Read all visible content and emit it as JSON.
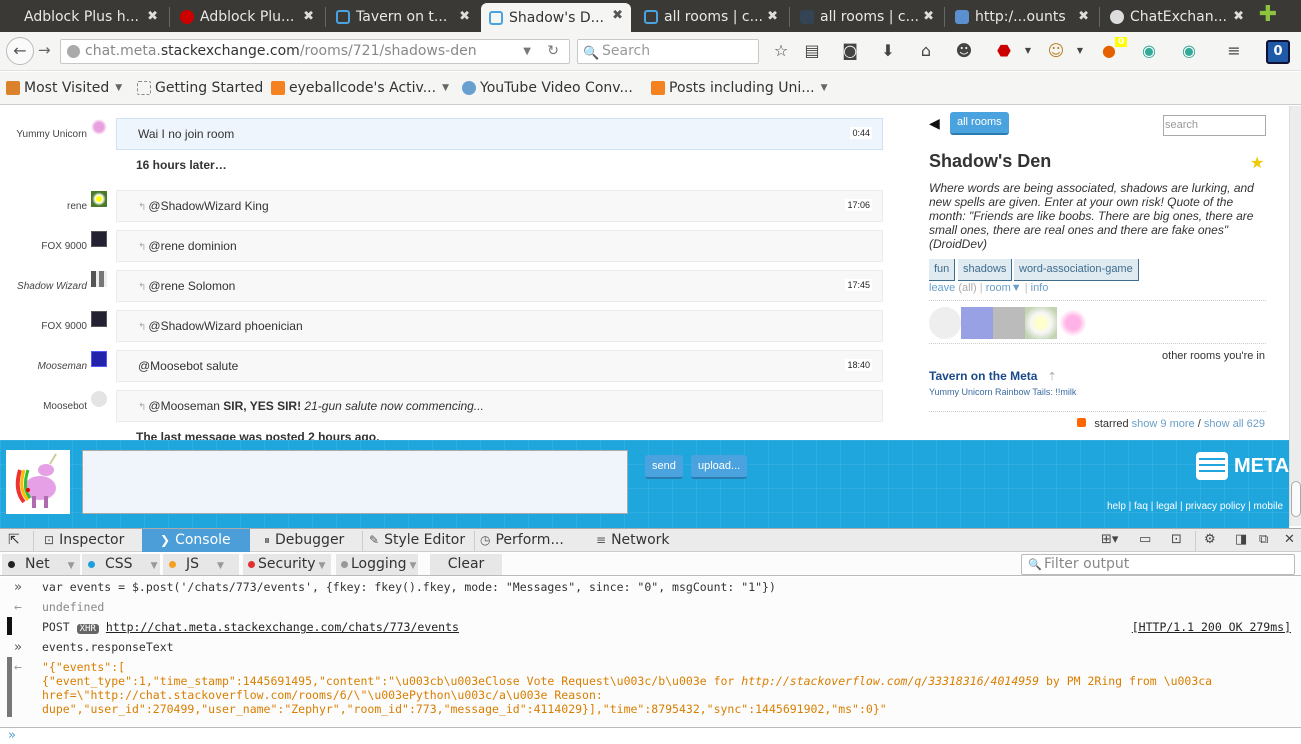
{
  "browser": {
    "tabs": [
      {
        "label": "Adblock Plus h...",
        "icon": "none"
      },
      {
        "label": "Adblock Plu...",
        "icon": "abp-icon"
      },
      {
        "label": "Tavern on t...",
        "icon": "chat-bubble-icon"
      },
      {
        "label": "Shadow's D...",
        "icon": "chat-bubble-icon",
        "active": true
      },
      {
        "label": "all rooms | c...",
        "icon": "chat-bubble-icon"
      },
      {
        "label": "all rooms | c...",
        "icon": "stackapps-icon"
      },
      {
        "label": "http:/...ounts",
        "icon": "stack-icon"
      },
      {
        "label": "ChatExchan...",
        "icon": "github-icon"
      }
    ],
    "close_glyph": "✖",
    "new_tab_glyph": "✚",
    "url": {
      "prefix": "chat.meta.",
      "domain": "stackexchange.com",
      "path": "/rooms/721/shadows-den"
    },
    "search_placeholder": "Search",
    "badge_count": "0",
    "bookmarks": [
      {
        "label": "Most Visited",
        "dropdown": true
      },
      {
        "label": "Getting Started",
        "dropdown": false
      },
      {
        "label": "eyeballcode's Activ...",
        "dropdown": true
      },
      {
        "label": "YouTube Video Conv...",
        "dropdown": false
      },
      {
        "label": "Posts including Uni...",
        "dropdown": true
      }
    ]
  },
  "chat": {
    "messages": [
      {
        "user": "Yummy Unicorn",
        "text": "Wai I no join room",
        "time": "0:44",
        "reply": false,
        "highlight": true
      },
      {
        "user": "rene",
        "text": "@ShadowWizard King",
        "time": "17:06",
        "reply": true
      },
      {
        "user": "FOX 9000",
        "text": "@rene dominion",
        "time": "",
        "reply": true
      },
      {
        "user": "Shadow Wizard",
        "text": "@rene Solomon",
        "time": "17:45",
        "reply": true,
        "italic_user": true
      },
      {
        "user": "FOX 9000",
        "text": "@ShadowWizard phoenician",
        "time": "",
        "reply": true
      },
      {
        "user": "Mooseman",
        "text": "@Moosebot salute",
        "time": "18:40",
        "reply": false,
        "italic_user": true
      },
      {
        "user": "Moosebot",
        "text_prefix": "@Mooseman ",
        "text_bold": "SIR, YES SIR!",
        "text_italic": " 21-gun salute now commencing...",
        "time": "",
        "reply": true
      }
    ],
    "time_gap": "16 hours later…",
    "last_message_notice": "The last message was posted 2 hours ago.",
    "send_label": "send",
    "upload_label": "upload...",
    "input_value": ""
  },
  "sidebar": {
    "all_rooms_label": "all rooms",
    "search_placeholder": "search",
    "room_title": "Shadow's Den",
    "room_description": "Where words are being associated, shadows are lurking, and new spells are given. Enter at your own risk! Quote of the month: \"Friends are like boobs. There are big ones, there are small ones, there are real ones and there are fake ones\" (DroidDev)",
    "tags": [
      "fun",
      "shadows",
      "word-association-game"
    ],
    "links": {
      "leave": "leave",
      "all": "(all)",
      "room": "room▼",
      "info": "info"
    },
    "other_rooms_label": "other rooms you're in",
    "other_room_name": "Tavern on the Meta",
    "other_room_last_message": "Yummy Unicorn Rainbow Tails: !!milk",
    "starred_label": "starred",
    "show_more": "show 9 more",
    "show_all": "show all 629",
    "slash": "/"
  },
  "footer": {
    "logo_text": "META",
    "links": "help | faq | legal | privacy policy | mobile"
  },
  "devtools": {
    "tabs": [
      {
        "label": "Inspector",
        "icon": "⊡"
      },
      {
        "label": "Console",
        "icon": "❯",
        "active": true
      },
      {
        "label": "Debugger",
        "icon": "⏸"
      },
      {
        "label": "Style Editor",
        "icon": "✎"
      },
      {
        "label": "Perform...",
        "icon": "◷"
      },
      {
        "label": "Network",
        "icon": "≡"
      }
    ],
    "filters": [
      {
        "label": "Net",
        "color": "#222222"
      },
      {
        "label": "CSS",
        "color": "#1ea0e0"
      },
      {
        "label": "JS",
        "color": "#f5a020"
      },
      {
        "label": "Security",
        "color": "#e03030"
      },
      {
        "label": "Logging",
        "color": "#999999"
      }
    ],
    "clear_label": "Clear",
    "filter_placeholder": "Filter output",
    "console": {
      "input1": "var events = $.post('/chats/773/events', {fkey: fkey().fkey, mode: \"Messages\", since: \"0\", msgCount: \"1\"})",
      "output1": "undefined",
      "net_method": "POST",
      "net_tag": "XHR",
      "net_url": "http://chat.meta.stackexchange.com/chats/773/events",
      "net_status": "[HTTP/1.1 200 OK 279ms]",
      "input2": "events.responseText",
      "output2_line1": "\"{\"events\":[",
      "output2_line2a": "{\"event_type\":1,\"time_stamp\":1445691495,\"content\":\"\\u003cb\\u003eClose Vote Request\\u003c/b\\u003e for ",
      "output2_line2b": "http://stackoverflow.com/q/33318316/4014959",
      "output2_line2c": " by PM 2Ring from \\u003ca",
      "output2_line3": "href=\\\"http://chat.stackoverflow.com/rooms/6/\\\"\\u003ePython\\u003c/a\\u003e Reason:",
      "output2_line4": "dupe\",\"user_id\":270499,\"user_name\":\"Zephyr\",\"room_id\":773,\"message_id\":4114029}],\"time\":8795432,\"sync\":1445691902,\"ms\":0}\""
    }
  }
}
